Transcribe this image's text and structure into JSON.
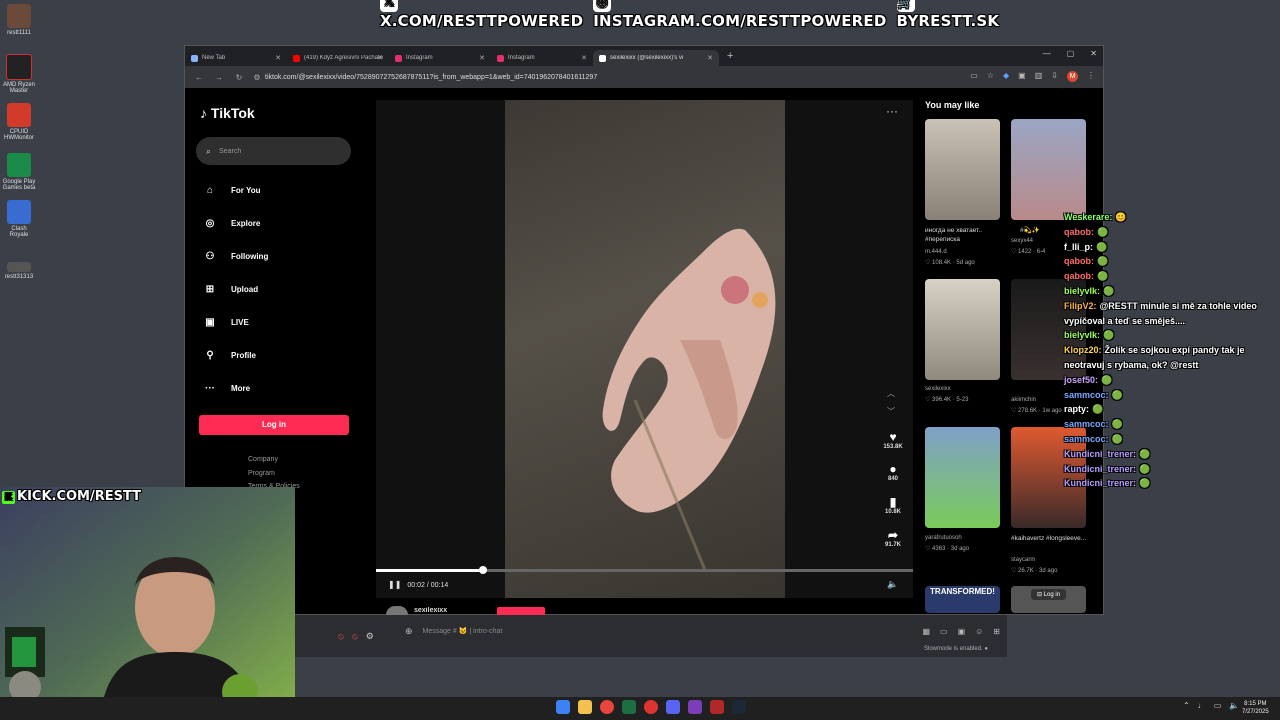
{
  "banner": {
    "x": "X.COM/RESTTPOWERED",
    "instagram": "INSTAGRAM.COM/RESTTPOWERED",
    "shop": "BYRESTT.SK"
  },
  "desktop_icons": [
    {
      "label": "restt1111"
    },
    {
      "label": "AMD Ryzen Master"
    },
    {
      "label": "CPUID HWMonitor"
    },
    {
      "label": "Google Play Games beta"
    },
    {
      "label": "Clash Royale"
    },
    {
      "label": "restt31313"
    }
  ],
  "browser": {
    "tabs": [
      {
        "title": "New Tab",
        "color": "#8ab4f8"
      },
      {
        "title": "(419) Když Agresivní Pachatelé",
        "color": "#ff0000"
      },
      {
        "title": "Instagram",
        "color": "#e1306c"
      },
      {
        "title": "Instagram",
        "color": "#e1306c"
      },
      {
        "title": "sexilexixx (@sexilexixx)'s vi",
        "color": "#ffffff"
      }
    ],
    "url": "tiktok.com/@sexilexixx/video/7528907275268787511?is_from_webapp=1&web_id=7401962078401611297",
    "profile_initial": "M"
  },
  "tiktok": {
    "logo": "TikTok",
    "search_placeholder": "Search",
    "nav": [
      {
        "label": "For You",
        "icon": "home-icon"
      },
      {
        "label": "Explore",
        "icon": "compass-icon"
      },
      {
        "label": "Following",
        "icon": "following-icon"
      },
      {
        "label": "Upload",
        "icon": "upload-icon"
      },
      {
        "label": "LIVE",
        "icon": "live-icon"
      },
      {
        "label": "Profile",
        "icon": "profile-icon"
      },
      {
        "label": "More",
        "icon": "more-icon"
      }
    ],
    "login": "Log in",
    "footer": [
      "Company",
      "Program",
      "Terms & Policies"
    ],
    "video": {
      "likes": "153.8K",
      "comments": "840",
      "saves": "10.8K",
      "shares": "91.7K",
      "time": "00:02 / 00:14",
      "progress": 0.2,
      "author": "sexilexixx"
    },
    "you_may_like_title": "You may like",
    "recommended": [
      {
        "caption": "иногда не хватает.. #переписка",
        "author": "m.444.d",
        "stats": "♡ 108.4K · 5d ago"
      },
      {
        "caption": "#💫✨",
        "author": "sexyx44",
        "stats": "♡ 1422 · 6-4"
      },
      {
        "caption": "",
        "author": "sexilexixx",
        "stats": "♡ 396.4K · 5-23"
      },
      {
        "caption": "",
        "author": "akiimchin",
        "stats": "♡ 278.6K · 1w ago"
      },
      {
        "caption": "",
        "author": "yarafrutuosoh",
        "stats": "♡ 4363 · 3d ago"
      },
      {
        "caption": "#kaihavertz #longsleeve...",
        "author": "staycarm",
        "stats": "♡ 26.7K · 3d ago"
      },
      {
        "caption": "TRANSFORMED!",
        "author": "",
        "stats": ""
      }
    ],
    "bottom_login": "Log in"
  },
  "chat": [
    {
      "user": "Weskerare:",
      "msg": "😊",
      "color": "#8aff6a"
    },
    {
      "user": "qabob:",
      "msg": "🟢",
      "color": "#ff6b6b"
    },
    {
      "user": "f_lli_p:",
      "msg": "🟢",
      "color": "#ffffff"
    },
    {
      "user": "qabob:",
      "msg": "🟢",
      "color": "#ff6b6b"
    },
    {
      "user": "qabob:",
      "msg": "🟢",
      "color": "#ff6b6b"
    },
    {
      "user": "bielyvlk:",
      "msg": "🟢",
      "color": "#9dff5a"
    },
    {
      "user": "FilipV2:",
      "msg": "@RESTT minule si mě za tohle video vypíčoval a teď se směješ....",
      "color": "#ffb347"
    },
    {
      "user": "bielyvlk:",
      "msg": "🟢",
      "color": "#9dff5a"
    },
    {
      "user": "Klopz20:",
      "msg": "Žolík se sojkou expí pandy tak je neotravuj s rybama, ok? @restt",
      "color": "#ffd54a"
    },
    {
      "user": "josef50:",
      "msg": "🟢",
      "color": "#c8a2ff"
    },
    {
      "user": "sammcoc:",
      "msg": "🟢",
      "color": "#7aa7ff"
    },
    {
      "user": "rapty:",
      "msg": "🟢",
      "color": "#ffffff"
    },
    {
      "user": "sammcoc:",
      "msg": "🟢",
      "color": "#7aa7ff"
    },
    {
      "user": "sammcoc:",
      "msg": "🟢",
      "color": "#7aa7ff"
    },
    {
      "user": "Kundicni_trener:",
      "msg": "🟢",
      "color": "#b79cff"
    },
    {
      "user": "Kundicni_trener:",
      "msg": "🟢",
      "color": "#b79cff"
    },
    {
      "user": "Kundicni_trener:",
      "msg": "🟢",
      "color": "#b79cff"
    }
  ],
  "discord": {
    "placeholder": "Message # 🐱 | intro-chat",
    "slowmode": "Slowmode is enabled."
  },
  "stream": {
    "kick": "KICK.COM/RESTT"
  },
  "taskbar": {
    "time": "8:15 PM",
    "date": "7/27/2025"
  }
}
